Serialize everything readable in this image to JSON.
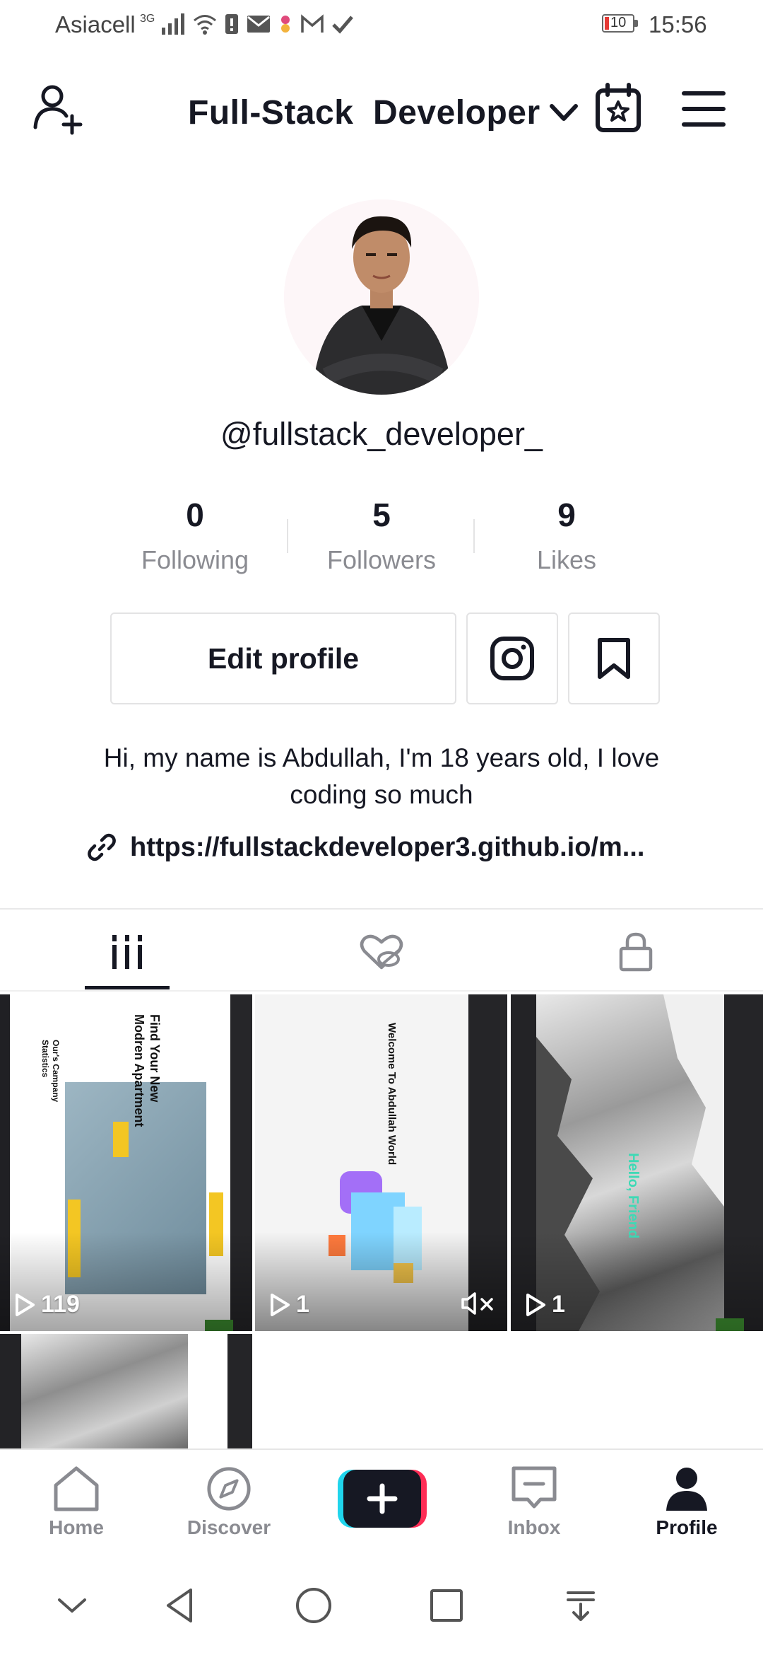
{
  "status_bar": {
    "carrier": "Asiacell",
    "network_type": "3G",
    "battery": "10",
    "time": "15:56"
  },
  "header": {
    "title": "Full-Stack  Developer",
    "icons": [
      "add-user-icon",
      "chevron-down-icon",
      "calendar-star-icon",
      "hamburger-menu-icon"
    ]
  },
  "profile": {
    "username": "@fullstack_developer_",
    "stats": [
      {
        "value": "0",
        "label": "Following"
      },
      {
        "value": "5",
        "label": "Followers"
      },
      {
        "value": "9",
        "label": "Likes"
      }
    ],
    "edit_label": "Edit profile",
    "bio": "Hi, my name is Abdullah, I'm 18 years old, I love coding so much",
    "link": "https://fullstackdeveloper3.github.io/m..."
  },
  "tabs": [
    {
      "icon": "videos-grid-icon",
      "active": true
    },
    {
      "icon": "liked-hidden-icon",
      "active": false
    },
    {
      "icon": "private-lock-icon",
      "active": false
    }
  ],
  "videos": [
    {
      "views": "119",
      "thumb_texts": [
        "Find Your New",
        "Modren Apartment",
        "Our's Campany",
        "Statistics"
      ]
    },
    {
      "views": "1",
      "thumb_texts": [
        "Welcome To Abdullah World"
      ]
    },
    {
      "views": "1",
      "thumb_texts": [
        "Hello, Friend"
      ]
    },
    {
      "views": "",
      "thumb_texts": []
    }
  ],
  "bottom_nav": [
    {
      "label": "Home",
      "icon": "home-icon"
    },
    {
      "label": "Discover",
      "icon": "compass-icon"
    },
    {
      "label": "",
      "icon": "plus-icon"
    },
    {
      "label": "Inbox",
      "icon": "inbox-icon"
    },
    {
      "label": "Profile",
      "icon": "profile-icon",
      "active": true
    }
  ],
  "colors": {
    "text": "#161823",
    "muted": "#8a8b91",
    "cyan": "#20d5ec",
    "pink": "#fe2c55"
  }
}
